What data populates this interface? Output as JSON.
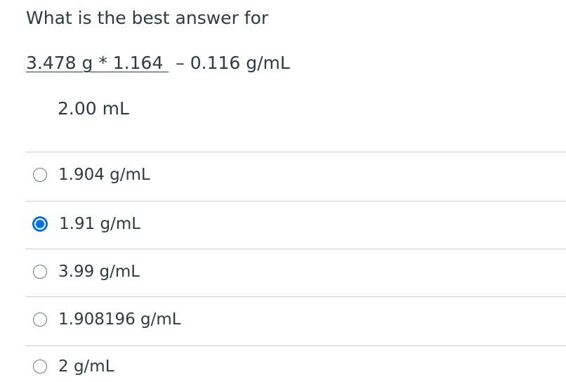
{
  "question": {
    "prompt": "What is the best answer for",
    "numerator": "3.478 g * 1.164 ",
    "subtract": "– 0.116 g/mL",
    "denominator": "2.00 mL"
  },
  "options": [
    {
      "label": "1.904 g/mL",
      "selected": false
    },
    {
      "label": "1.91 g/mL",
      "selected": true
    },
    {
      "label": "3.99 g/mL",
      "selected": false
    },
    {
      "label": "1.908196 g/mL",
      "selected": false
    },
    {
      "label": "2 g/mL",
      "selected": false
    }
  ],
  "colors": {
    "text": "#2d3b45",
    "divider": "#c7cdd1",
    "radio_selected": "#0770e3",
    "radio_border": "#6b7780"
  }
}
